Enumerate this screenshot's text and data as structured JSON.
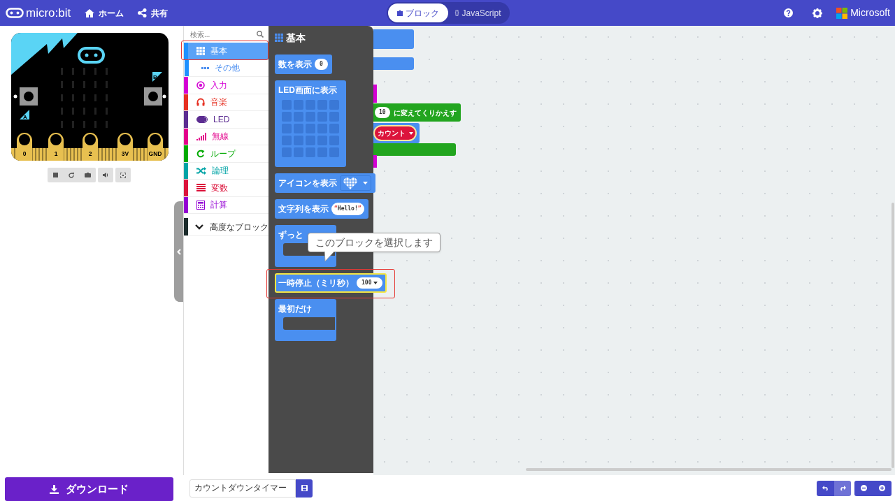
{
  "header": {
    "logo": "micro:bit",
    "nav": [
      {
        "label": "ホーム"
      },
      {
        "label": "共有"
      }
    ],
    "editor_tabs": [
      {
        "label": "ブロック",
        "kind": "blocks",
        "selected": true
      },
      {
        "label": "JavaScript",
        "kind": "code",
        "icon_text": "{}",
        "selected": false
      }
    ],
    "brand": "Microsoft"
  },
  "simulator": {
    "button_labels": [
      "A",
      "B"
    ],
    "pins": [
      "0",
      "1",
      "2",
      "3V",
      "GND"
    ]
  },
  "toolbox": {
    "search": {
      "placeholder": "検索..."
    },
    "categories": [
      {
        "label": "基本",
        "color": "#1e90ff",
        "selected": true,
        "children": [
          {
            "label": "その他",
            "selected": false
          }
        ]
      },
      {
        "label": "入力",
        "color": "#d400d4",
        "selected": false
      },
      {
        "label": "音楽",
        "color": "#e63022",
        "selected": false
      },
      {
        "label": "LED",
        "color": "#5c2d91",
        "selected": false
      },
      {
        "label": "無線",
        "color": "#e3008c",
        "selected": false
      },
      {
        "label": "ループ",
        "color": "#00aa00",
        "selected": false
      },
      {
        "label": "論理",
        "color": "#00a4a6",
        "selected": false
      },
      {
        "label": "変数",
        "color": "#dc143c",
        "selected": false
      },
      {
        "label": "計算",
        "color": "#9400d3",
        "selected": false
      }
    ],
    "advanced": "高度なブロック"
  },
  "flyout": {
    "title": "基本",
    "blocks": [
      {
        "kind": "value",
        "label": "数を表示",
        "value": "0",
        "highlighted": false
      },
      {
        "kind": "grid",
        "label": "LED画面に表示",
        "highlighted": false
      },
      {
        "kind": "icon",
        "label": "アイコンを表示",
        "highlighted": false
      },
      {
        "kind": "text",
        "label": "文字列を表示",
        "value": "Hello!",
        "quotes": [
          "“",
          "”"
        ],
        "highlighted": false
      },
      {
        "kind": "c",
        "label": "ずっと",
        "highlighted": false
      },
      {
        "kind": "dropdown",
        "label": "一時停止（ミリ秒）",
        "value": "100",
        "highlighted": true
      },
      {
        "kind": "c",
        "label": "最初だけ",
        "highlighted": false
      }
    ]
  },
  "tooltip": "このブロックを選択します",
  "workspace": {
    "repeat_count": "10",
    "repeat_label": "に変えてくりかえす",
    "variable": "カウント"
  },
  "footer": {
    "download": "ダウンロード",
    "project_name": "カウントダウンタイマー"
  }
}
